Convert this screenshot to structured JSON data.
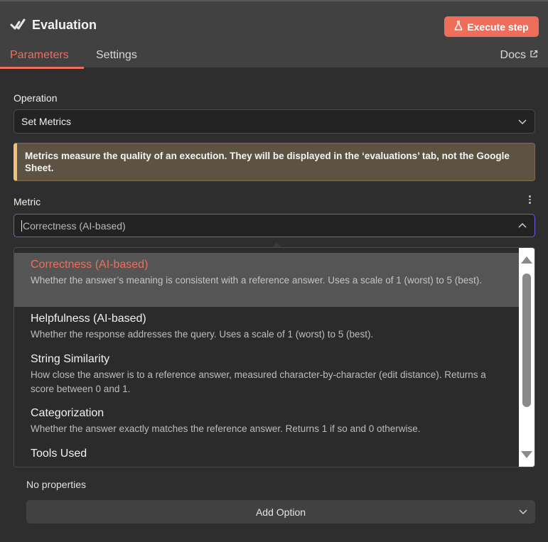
{
  "header": {
    "title": "Evaluation",
    "execute_label": "Execute step",
    "tabs": [
      {
        "label": "Parameters",
        "active": true
      },
      {
        "label": "Settings",
        "active": false
      }
    ],
    "docs_label": "Docs"
  },
  "operation": {
    "label": "Operation",
    "value": "Set Metrics"
  },
  "notice": {
    "text": "Metrics measure the quality of an execution. They will be displayed in the ‘evaluations’ tab, not the Google Sheet."
  },
  "metric": {
    "label": "Metric",
    "placeholder": "Correctness (AI-based)"
  },
  "dropdown": {
    "options": [
      {
        "name": "Correctness (AI-based)",
        "desc": "Whether the answer’s meaning is consistent with a reference answer. Uses a scale of 1 (worst) to 5 (best).",
        "selected": true
      },
      {
        "name": "Helpfulness (AI-based)",
        "desc": "Whether the response addresses the query. Uses a scale of 1 (worst) to 5 (best).",
        "selected": false
      },
      {
        "name": "String Similarity",
        "desc": "How close the answer is to a reference answer, measured character-by-character (edit distance). Returns a score between 0 and 1.",
        "selected": false
      },
      {
        "name": "Categorization",
        "desc": "Whether the answer exactly matches the reference answer. Returns 1 if so and 0 otherwise.",
        "selected": false
      },
      {
        "name": "Tools Used",
        "desc": "",
        "selected": false
      }
    ]
  },
  "options_section": {
    "empty_text": "No properties",
    "add_option_label": "Add Option"
  },
  "colors": {
    "accent": "#ef6e5b",
    "focus_border": "#6b5fd6",
    "notice_bg": "#5e5242",
    "notice_bar": "#f2c077"
  },
  "icons": {
    "title": "check-double-icon",
    "execute": "flask-icon",
    "docs": "external-link-icon",
    "select": "chevron-down-icon",
    "metric": "chevron-up-icon",
    "more": "kebab-menu-icon"
  }
}
